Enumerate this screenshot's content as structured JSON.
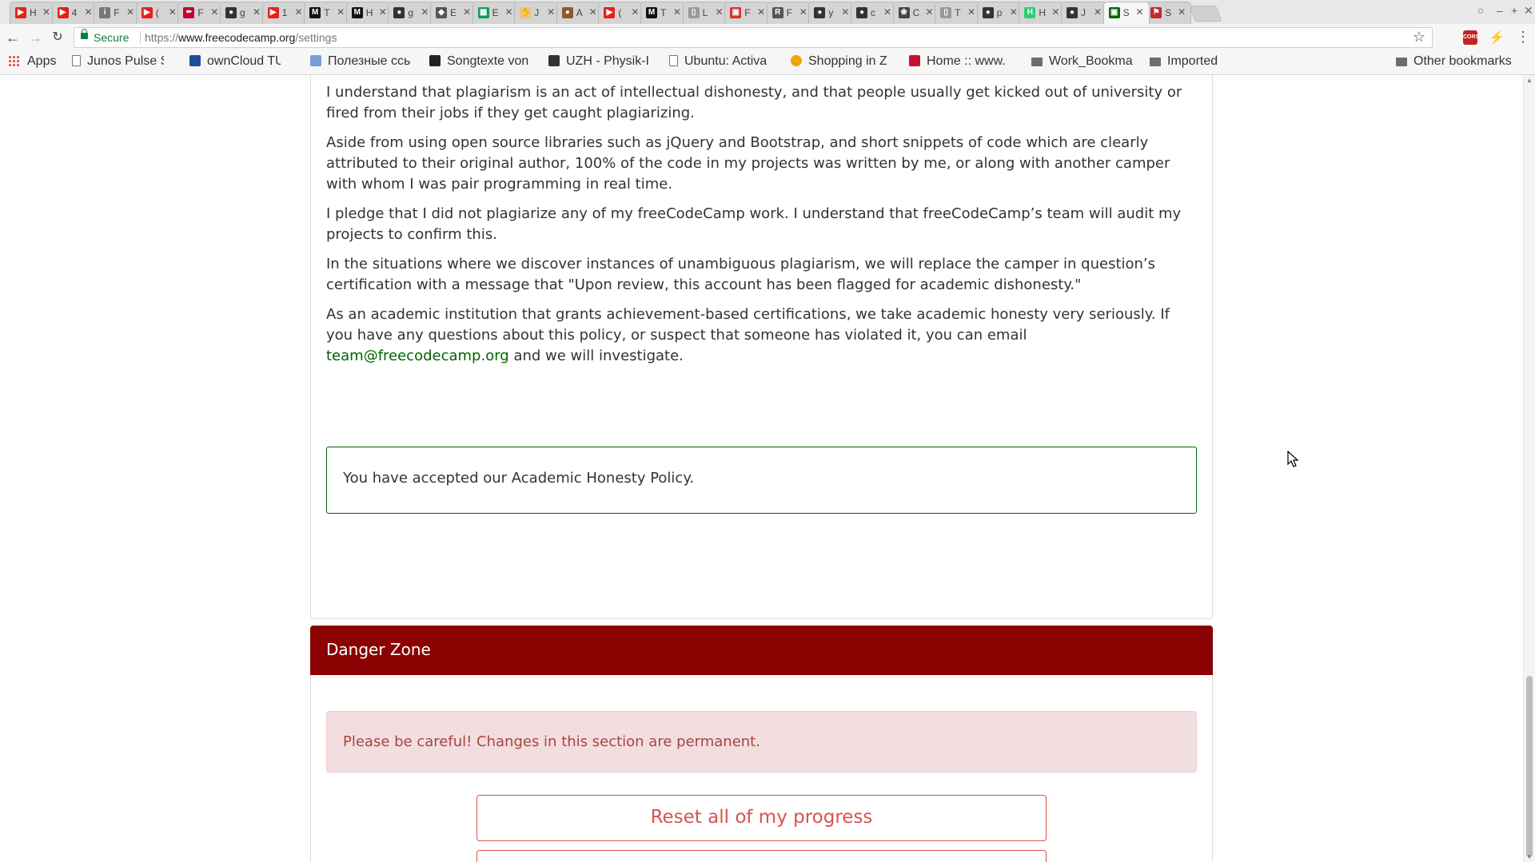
{
  "browser": {
    "tabs": [
      {
        "title": "H",
        "favicon": "youtube-favicon"
      },
      {
        "title": "4",
        "favicon": "youtube-favicon"
      },
      {
        "title": "F",
        "favicon": "info-favicon"
      },
      {
        "title": "(",
        "favicon": "youtube-favicon"
      },
      {
        "title": "F",
        "favicon": "script-favicon"
      },
      {
        "title": "g",
        "favicon": "github-favicon"
      },
      {
        "title": "1",
        "favicon": "youtube-favicon"
      },
      {
        "title": "T",
        "favicon": "medium-favicon"
      },
      {
        "title": "H",
        "favicon": "medium-favicon"
      },
      {
        "title": "g",
        "favicon": "github-favicon"
      },
      {
        "title": "E",
        "favicon": "diamond-favicon"
      },
      {
        "title": "E",
        "favicon": "sheets-favicon"
      },
      {
        "title": "J",
        "favicon": "hand-favicon"
      },
      {
        "title": "A",
        "favicon": "bear-favicon"
      },
      {
        "title": "(",
        "favicon": "youtube-favicon"
      },
      {
        "title": "T",
        "favicon": "medium-favicon"
      },
      {
        "title": "L",
        "favicon": "page-favicon"
      },
      {
        "title": "F",
        "favicon": "pdf-favicon"
      },
      {
        "title": "F",
        "favicon": "r-favicon"
      },
      {
        "title": "y",
        "favicon": "github-favicon"
      },
      {
        "title": "c",
        "favicon": "github-favicon"
      },
      {
        "title": "C",
        "favicon": "openai-favicon"
      },
      {
        "title": "T",
        "favicon": "page-favicon"
      },
      {
        "title": "p",
        "favicon": "github-favicon"
      },
      {
        "title": "H",
        "favicon": "h-favicon"
      },
      {
        "title": "J",
        "favicon": "github-favicon"
      },
      {
        "title": "S",
        "favicon": "freecodecamp-favicon"
      },
      {
        "title": "S",
        "favicon": "flag-favicon"
      }
    ],
    "address": {
      "secure_label": "Secure",
      "url_scheme": "https://",
      "url_host": "www.freecodecamp.org",
      "url_path": "/settings"
    },
    "bookmarks": {
      "apps_label": "Apps",
      "items": [
        {
          "label": "Junos Pulse Se",
          "icon": "page-icon"
        },
        {
          "label": "ownCloud TU",
          "icon": "tu-icon"
        },
        {
          "label": "Полезные ссы",
          "icon": "diamond-icon"
        },
        {
          "label": "Songtexte von",
          "icon": "m-icon"
        },
        {
          "label": "UZH - Physik-I",
          "icon": "uzh-icon"
        },
        {
          "label": "Ubuntu: Activa",
          "icon": "page-icon"
        },
        {
          "label": "Shopping in Zi",
          "icon": "orange-circle-icon"
        },
        {
          "label": "Home :: www.",
          "icon": "red-building-icon"
        },
        {
          "label": "Work_Bookma",
          "icon": "folder-icon"
        },
        {
          "label": "Imported",
          "icon": "folder-icon"
        }
      ],
      "other_label": "Other bookmarks"
    }
  },
  "page": {
    "honesty": {
      "paragraphs": [
        "I understand that plagiarism is an act of intellectual dishonesty, and that people usually get kicked out of university or fired from their jobs if they get caught plagiarizing.",
        "Aside from using open source libraries such as jQuery and Bootstrap, and short snippets of code which are clearly attributed to their original author, 100% of the code in my projects was written by me, or along with another camper with whom I was pair programming in real time.",
        "I pledge that I did not plagiarize any of my freeCodeCamp work. I understand that freeCodeCamp’s team will audit my projects to confirm this.",
        "In the situations where we discover instances of unambiguous plagiarism, we will replace the camper in question’s certification with a message that \"Upon review, this account has been flagged for academic dishonesty.\""
      ],
      "last_paragraph_before": "As an academic institution that grants achievement-based certifications, we take academic honesty very seriously. If you have any questions about this policy, or suspect that someone has violated it, you can email ",
      "email": "team@freecodecamp.org",
      "last_paragraph_after": " and we will investigate.",
      "accepted_text": "You have accepted our Academic Honesty Policy."
    },
    "danger_zone": {
      "title": "Danger Zone",
      "alert": "Please be careful! Changes in this section are permanent.",
      "reset_button": "Reset all of my progress"
    }
  },
  "colors": {
    "fcc_green": "#006400",
    "danger_header": "#8b0000",
    "danger_text": "#d9534f",
    "alert_bg": "#f2dede",
    "alert_text": "#a94442"
  }
}
